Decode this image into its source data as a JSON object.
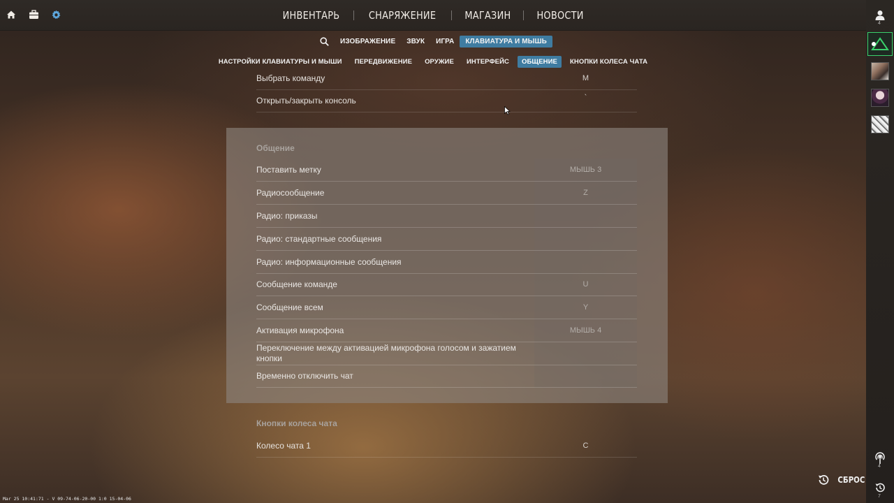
{
  "top_left_icons": [
    "home-icon",
    "briefcase-icon",
    "gear-icon"
  ],
  "main_nav": [
    "ИНВЕНТАРЬ",
    "СНАРЯЖЕНИЕ",
    "МАГАЗИН",
    "НОВОСТИ"
  ],
  "settings_tabs": {
    "search_icon": "search-icon",
    "items": [
      "ИЗОБРАЖЕНИЕ",
      "ЗВУК",
      "ИГРА",
      "КЛАВИАТУРА И МЫШЬ"
    ],
    "active": "КЛАВИАТУРА И МЫШЬ"
  },
  "keyboard_tabs": {
    "items": [
      "НАСТРОЙКИ КЛАВИАТУРЫ И МЫШИ",
      "ПЕРЕДВИЖЕНИЕ",
      "ОРУЖИЕ",
      "ИНТЕРФЕЙС",
      "ОБЩЕНИЕ",
      "КНОПКИ КОЛЕСА ЧАТА"
    ],
    "active": "ОБЩЕНИЕ"
  },
  "top_rows": [
    {
      "label": "Выбрать команду",
      "key": "M"
    },
    {
      "label": "Открыть/закрыть консоль",
      "key": "`"
    }
  ],
  "communication": {
    "title": "Общение",
    "rows": [
      {
        "label": "Поставить метку",
        "key": "МЫШЬ 3"
      },
      {
        "label": "Радиосообщение",
        "key": "Z"
      },
      {
        "label": "Радио: приказы",
        "key": ""
      },
      {
        "label": "Радио: стандартные сообщения",
        "key": ""
      },
      {
        "label": "Радио: информационные сообщения",
        "key": ""
      },
      {
        "label": "Сообщение команде",
        "key": "U"
      },
      {
        "label": "Сообщение всем",
        "key": "Y"
      },
      {
        "label": "Активация микрофона",
        "key": "МЫШЬ 4"
      },
      {
        "label": "Переключение между активацией микрофона голосом и зажатием кнопки",
        "key": ""
      },
      {
        "label": "Временно отключить чат",
        "key": ""
      }
    ]
  },
  "chat_wheel": {
    "title": "Кнопки колеса чата",
    "rows": [
      {
        "label": "Колесо чата 1",
        "key": "C"
      }
    ]
  },
  "right_rail": {
    "profile_count": "4",
    "signal_count": "4",
    "history_count": "7"
  },
  "reset_label": "СБРОС",
  "debug_text": "Mar 25 10:41:71 - V 09-74-06-20-00 1:0 15-04-06",
  "colors": {
    "accent": "#3f7ca1",
    "rank_green": "#3ad16b"
  }
}
